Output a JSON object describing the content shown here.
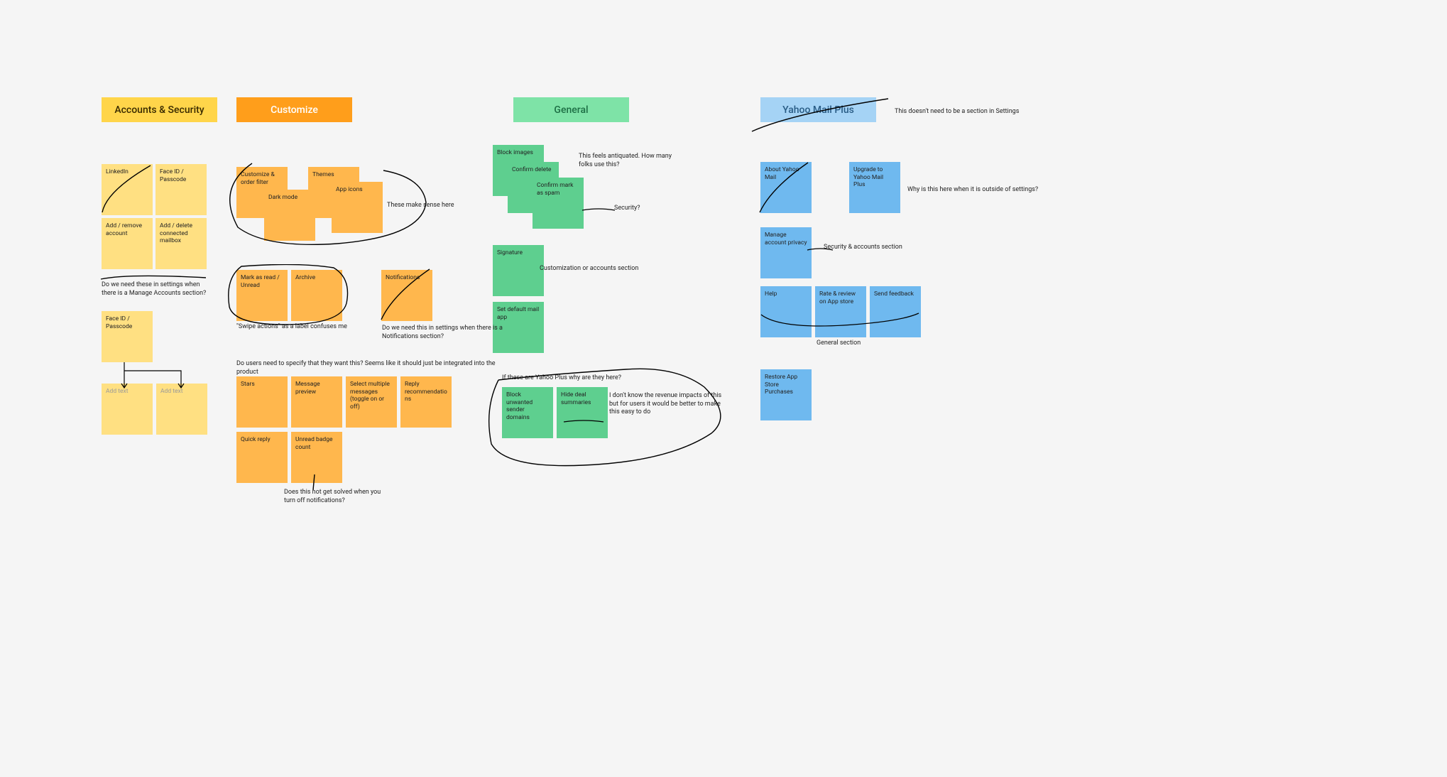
{
  "colors": {
    "yellow_hdr": "#ffd54a",
    "yellow_note": "#ffe082",
    "orange_hdr": "#ff9e1b",
    "orange_note": "#ffb74d",
    "green_hdr": "#7ee3a7",
    "green_note": "#5ecf8f",
    "blue_hdr": "#a5d3f5",
    "blue_note": "#6fb9ef",
    "hdr_text_dark": "#3a2b00",
    "hdr_text_dark2": "#5a3a00",
    "hdr_text_green": "#1e6f45",
    "hdr_text_blue": "#2a5d86"
  },
  "headers": {
    "accounts": "Accounts & Security",
    "customize": "Customize",
    "general": "General",
    "ymp": "Yahoo Mail Plus"
  },
  "annotations": {
    "a1": "Do we need these in settings when there is a Manage Accounts section?",
    "a2": "These make sense here",
    "a3": "\"Swipe actions\" as a label confuses me",
    "a4": "Do we need this in settings when there is a Notifications section?",
    "a5": "Do users need to specify that they want this? Seems like it should just be integrated into the product",
    "a6": "Does this not get solved when you turn off notifications?",
    "a7": "This feels antiquated. How many folks use this?",
    "a8": "Security?",
    "a9": "Customization or accounts section",
    "a10": "If these are Yahoo Plus why are they here?",
    "a11": "I don't know the revenue impacts of this but for users it would be better to make this easy to do",
    "a12": "This doesn't need to be a section in Settings",
    "a13": "Why is this here when it is outside of settings?",
    "a14": "Security & accounts section",
    "a15": "General section"
  },
  "notes": {
    "y1": "LinkedIn",
    "y2": "Face ID / Passcode",
    "y3": "Add / remove account",
    "y4": "Add / delete connected mailbox",
    "y5": "Face ID / Passcode",
    "y6": "Add text",
    "y7": "Add text",
    "o1": "Customize & order filter",
    "o2": "Themes",
    "o3": "Dark mode",
    "o4": "App icons",
    "o5": "Mark as read / Unread",
    "o6": "Archive",
    "o7": "Notifications",
    "o8": "Stars",
    "o9": "Message preview",
    "o10": "Select multiple messages (toggle on or off)",
    "o11": "Reply recommendations",
    "o12": "Quick reply",
    "o13": "Unread badge count",
    "g1": "Block images",
    "g2": "Confirm delete",
    "g3": "Confirm mark as spam",
    "g4": "Signature",
    "g5": "Set default mail app",
    "g6": "Block unwanted sender domains",
    "g7": "Hide deal summaries",
    "b1": "About Yahoo Mail",
    "b2": "Upgrade to Yahoo Mail Plus",
    "b3": "Manage account privacy",
    "b4": "Help",
    "b5": "Rate & review on App store",
    "b6": "Send feedback",
    "b7": "Restore App Store Purchases"
  }
}
